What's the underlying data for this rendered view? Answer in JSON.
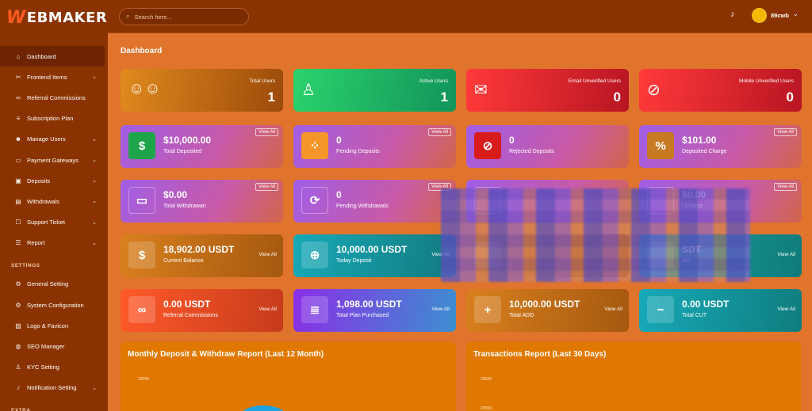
{
  "brand": {
    "logo_initial": "W",
    "logo_rest": "EBMAKER",
    "accent": "#ff5a1f"
  },
  "sidebar": {
    "items": [
      {
        "label": "Dashboard",
        "icon": "home-icon",
        "glyph": "⌂",
        "chevron": "",
        "active": true
      },
      {
        "label": "Frontend Items",
        "icon": "tools-icon",
        "glyph": "✂",
        "chevron": "⌄"
      },
      {
        "label": "Referral Commissions",
        "icon": "link-icon",
        "glyph": "∞",
        "chevron": ""
      },
      {
        "label": "Subscription Plan",
        "icon": "list-icon",
        "glyph": "≡",
        "chevron": ""
      },
      {
        "label": "Manage Users",
        "icon": "users-icon",
        "glyph": "☻",
        "chevron": "⌄"
      },
      {
        "label": "Payment Gateways",
        "icon": "card-icon",
        "glyph": "▭",
        "chevron": "⌄"
      },
      {
        "label": "Deposits",
        "icon": "wallet-icon",
        "glyph": "▣",
        "chevron": "⌄"
      },
      {
        "label": "Withdrawals",
        "icon": "bank-icon",
        "glyph": "▤",
        "chevron": "⌄"
      },
      {
        "label": "Support Ticket",
        "icon": "ticket-icon",
        "glyph": "☐",
        "chevron": "⌄"
      },
      {
        "label": "Report",
        "icon": "report-icon",
        "glyph": "☰",
        "chevron": "⌄"
      }
    ],
    "settings_header": "SETTINGS",
    "settings_items": [
      {
        "label": "General Setting",
        "icon": "gear-icon",
        "glyph": "⚙",
        "chevron": ""
      },
      {
        "label": "System Configuration",
        "icon": "cog-icon",
        "glyph": "⚙",
        "chevron": ""
      },
      {
        "label": "Logo & Favicon",
        "icon": "image-icon",
        "glyph": "▨",
        "chevron": ""
      },
      {
        "label": "SEO Manager",
        "icon": "globe-icon",
        "glyph": "◍",
        "chevron": ""
      },
      {
        "label": "KYC Setting",
        "icon": "user-check-icon",
        "glyph": "♙",
        "chevron": ""
      },
      {
        "label": "Notification Setting",
        "icon": "bell-icon",
        "glyph": "♪",
        "chevron": "⌄"
      }
    ],
    "extra_header": "EXTRA"
  },
  "topbar": {
    "search_placeholder": "Search here...",
    "username": "89cwb"
  },
  "page_title": "Dashboard",
  "stats_top": [
    {
      "label": "Total Users",
      "value": "1",
      "icon": "users-group-icon",
      "glyph": "☺☺",
      "bg": "linear-gradient(100deg,#e08a1e,#9c4a0a)"
    },
    {
      "label": "Active Users",
      "value": "1",
      "icon": "user-check-icon",
      "glyph": "♙",
      "bg": "linear-gradient(100deg,#2bd36c,#12945a)"
    },
    {
      "label": "Email Unverified Users",
      "value": "0",
      "icon": "envelope-icon",
      "glyph": "✉",
      "bg": "linear-gradient(100deg,#ff3a3a,#b81522)"
    },
    {
      "label": "Mobile Unverified Users",
      "value": "0",
      "icon": "mobile-slash-icon",
      "glyph": "⊘",
      "bg": "linear-gradient(100deg,#ff3a3a,#b81522)"
    }
  ],
  "stats_row2": [
    {
      "value": "$10,000.00",
      "label": "Total Deposited",
      "icon": "hand-money-icon",
      "glyph": "$",
      "sq": "#1ea54a",
      "view": "View All"
    },
    {
      "value": "0",
      "label": "Pending Deposits",
      "icon": "spinner-icon",
      "glyph": "⁘",
      "sq": "#f5962a",
      "view": "View All"
    },
    {
      "value": "0",
      "label": "Rejected Deposits",
      "icon": "ban-icon",
      "glyph": "⊘",
      "sq": "#d81b1b",
      "view": ""
    },
    {
      "value": "$101.00",
      "label": "Deposited Charge",
      "icon": "percent-icon",
      "glyph": "%",
      "sq": "#c87a22",
      "view": "View All"
    }
  ],
  "stats_row3": [
    {
      "value": "$0.00",
      "label": "Total Withdrawan",
      "icon": "bill-icon",
      "glyph": "▭",
      "view": "View All"
    },
    {
      "value": "0",
      "label": "Pending Withdrawals",
      "icon": "sync-icon",
      "glyph": "⟳",
      "view": "View All"
    },
    {
      "value": "",
      "label": "",
      "icon": "hidden-icon",
      "glyph": "",
      "view": ""
    },
    {
      "value": "$0.00",
      "label": "l Charge",
      "icon": "hidden-icon",
      "glyph": "",
      "view": "View All"
    }
  ],
  "stats_row4": [
    {
      "value": "18,902.00 USDT",
      "label": "Current Balance",
      "icon": "hand-money-icon",
      "glyph": "$",
      "view": "View All",
      "bg": "linear-gradient(100deg,#d9801e,#a5580f)"
    },
    {
      "value": "10,000.00 USDT",
      "label": "Today Deposit",
      "icon": "cart-plus-icon",
      "glyph": "⊕",
      "view": "View All",
      "bg": "linear-gradient(100deg,#17a9b8,#127a7e)"
    },
    {
      "value": "",
      "label": "",
      "icon": "hidden-icon",
      "glyph": "",
      "view": "",
      "bg": "linear-gradient(100deg,#e07c22,#b35410)"
    },
    {
      "value": "SDT",
      "label": "tion",
      "icon": "hidden-icon",
      "glyph": "",
      "view": "View All",
      "bg": "linear-gradient(100deg,#19a7a4,#0f7b7a)"
    }
  ],
  "stats_row5": [
    {
      "value": "0.00 USDT",
      "label": "Referral Commissions",
      "icon": "link-icon",
      "glyph": "∞",
      "view": "View All",
      "bg": "linear-gradient(100deg,#ff5a2a,#c63b1b)"
    },
    {
      "value": "1,098.00 USDT",
      "label": "Total Plan Purchased",
      "icon": "list-icon",
      "glyph": "≣",
      "view": "View All",
      "bg": "linear-gradient(100deg,#8b2ee6,#3c8fd0)"
    },
    {
      "value": "10,000.00 USDT",
      "label": "Total ADD",
      "icon": "plus-circle-icon",
      "glyph": "+",
      "view": "View All",
      "bg": "linear-gradient(100deg,#d9801e,#a5580f)"
    },
    {
      "value": "0.00 USDT",
      "label": "Total CUT",
      "icon": "minus-circle-icon",
      "glyph": "−",
      "view": "View All",
      "bg": "linear-gradient(100deg,#17a9b8,#0f7d7e)"
    }
  ],
  "panels": [
    {
      "title": "Monthly Deposit & Withdraw Report (Last 12 Month)",
      "tick": "12000"
    },
    {
      "title": "Transactions Report (Last 30 Days)",
      "tick1": "25000",
      "tick2": "20000"
    }
  ]
}
